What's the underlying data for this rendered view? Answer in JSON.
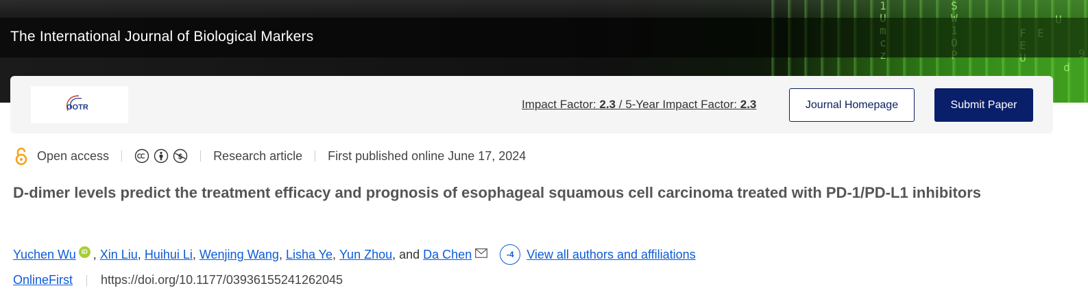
{
  "banner": {
    "journal_title": "The International Journal of Biological Markers",
    "matrix_glyphs": [
      "1Umcz",
      "SW1OP",
      "FEU",
      "E",
      "U",
      "d",
      "9"
    ]
  },
  "card": {
    "logo_text": "OOTR",
    "impact_label": "Impact Factor: ",
    "impact_value": "2.3",
    "impact_sep": " / ",
    "five_year_label": "5-Year Impact Factor: ",
    "five_year_value": "2.3",
    "journal_homepage_label": "Journal Homepage",
    "submit_paper_label": "Submit Paper"
  },
  "meta": {
    "open_access": "Open access",
    "article_type": "Research article",
    "published": "First published online June 17, 2024",
    "license_icons": [
      "cc-icon",
      "by-icon",
      "nc-icon"
    ]
  },
  "article": {
    "title": "D-dimer levels predict the treatment efficacy and prognosis of esophageal squamous cell carcinoma treated with PD-1/PD-L1 inhibitors"
  },
  "authors": {
    "list": [
      "Yuchen Wu",
      "Xin Liu",
      "Huihui Li",
      "Wenjing Wang",
      "Lisha Ye",
      "Yun Zhou"
    ],
    "orcid_label": "iD",
    "and_text": ", and ",
    "last_author": "Da Chen",
    "more_count": "-4",
    "view_all_label": "View all authors and affiliations"
  },
  "doi": {
    "online_first": "OnlineFirst",
    "doi_url": "https://doi.org/10.1177/03936155241262045"
  },
  "colors": {
    "primary_navy": "#0a1f6a",
    "link_blue": "#0b5bd6",
    "orcid_green": "#a6ce39",
    "open_access_orange": "#f7a21b"
  }
}
